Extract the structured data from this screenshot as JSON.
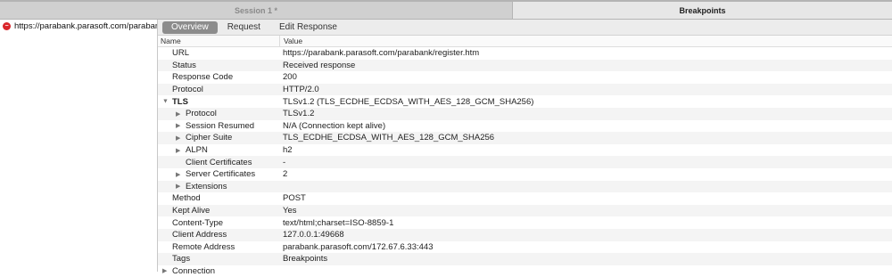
{
  "window_tabs": [
    {
      "label": "Session 1 *",
      "active": false
    },
    {
      "label": "Breakpoints",
      "active": true
    }
  ],
  "requests": [
    {
      "url": "https://parabank.parasoft.com/parabank",
      "icon": "breakpoint-icon"
    }
  ],
  "detail_tabs": [
    {
      "label": "Overview",
      "active": true
    },
    {
      "label": "Request",
      "active": false
    },
    {
      "label": "Edit Response",
      "active": false
    }
  ],
  "columns": {
    "name": "Name",
    "value": "Value"
  },
  "rows": [
    {
      "name": "URL",
      "value": "https://parabank.parasoft.com/parabank/register.htm",
      "level": 0,
      "expander": "none"
    },
    {
      "name": "Status",
      "value": "Received response",
      "level": 0,
      "expander": "none"
    },
    {
      "name": "Response Code",
      "value": "200",
      "level": 0,
      "expander": "none"
    },
    {
      "name": "Protocol",
      "value": "HTTP/2.0",
      "level": 0,
      "expander": "none"
    },
    {
      "name": "TLS",
      "value": "TLSv1.2 (TLS_ECDHE_ECDSA_WITH_AES_128_GCM_SHA256)",
      "level": 0,
      "expander": "expanded",
      "bold": true
    },
    {
      "name": "Protocol",
      "value": "TLSv1.2",
      "level": 1,
      "expander": "collapsed"
    },
    {
      "name": "Session Resumed",
      "value": "N/A (Connection kept alive)",
      "level": 1,
      "expander": "collapsed"
    },
    {
      "name": "Cipher Suite",
      "value": "TLS_ECDHE_ECDSA_WITH_AES_128_GCM_SHA256",
      "level": 1,
      "expander": "collapsed"
    },
    {
      "name": "ALPN",
      "value": "h2",
      "level": 1,
      "expander": "collapsed"
    },
    {
      "name": "Client Certificates",
      "value": "-",
      "level": 1,
      "expander": "none"
    },
    {
      "name": "Server Certificates",
      "value": "2",
      "level": 1,
      "expander": "collapsed"
    },
    {
      "name": "Extensions",
      "value": "",
      "level": 1,
      "expander": "collapsed"
    },
    {
      "name": "Method",
      "value": "POST",
      "level": 0,
      "expander": "none"
    },
    {
      "name": "Kept Alive",
      "value": "Yes",
      "level": 0,
      "expander": "none"
    },
    {
      "name": "Content-Type",
      "value": "text/html;charset=ISO-8859-1",
      "level": 0,
      "expander": "none"
    },
    {
      "name": "Client Address",
      "value": "127.0.0.1:49668",
      "level": 0,
      "expander": "none"
    },
    {
      "name": "Remote Address",
      "value": "parabank.parasoft.com/172.67.6.33:443",
      "level": 0,
      "expander": "none"
    },
    {
      "name": "Tags",
      "value": "Breakpoints",
      "level": 0,
      "expander": "none"
    },
    {
      "name": "Connection",
      "value": "",
      "level": 0,
      "expander": "collapsed"
    }
  ]
}
